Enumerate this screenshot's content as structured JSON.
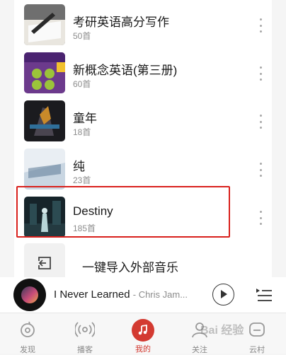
{
  "playlists": [
    {
      "title": "考研英语高分写作",
      "count": "50首"
    },
    {
      "title": "新概念英语(第三册)",
      "count": "60首"
    },
    {
      "title": "童年",
      "count": "18首"
    },
    {
      "title": "纯",
      "count": "23首"
    },
    {
      "title": "Destiny",
      "count": "185首"
    }
  ],
  "import": {
    "label": "一键导入外部音乐"
  },
  "player": {
    "song": "I Never Learned",
    "artist": "- Chris Jam..."
  },
  "tabs": [
    {
      "label": "发现",
      "icon": "discover-icon"
    },
    {
      "label": "播客",
      "icon": "podcast-icon"
    },
    {
      "label": "我的",
      "icon": "music-note-icon"
    },
    {
      "label": "关注",
      "icon": "user-icon"
    },
    {
      "label": "云村",
      "icon": "cloud-village-icon"
    }
  ],
  "colors": {
    "accent": "#d33a31",
    "highlight_border": "#d9201c"
  },
  "watermark": "Bai 经验"
}
